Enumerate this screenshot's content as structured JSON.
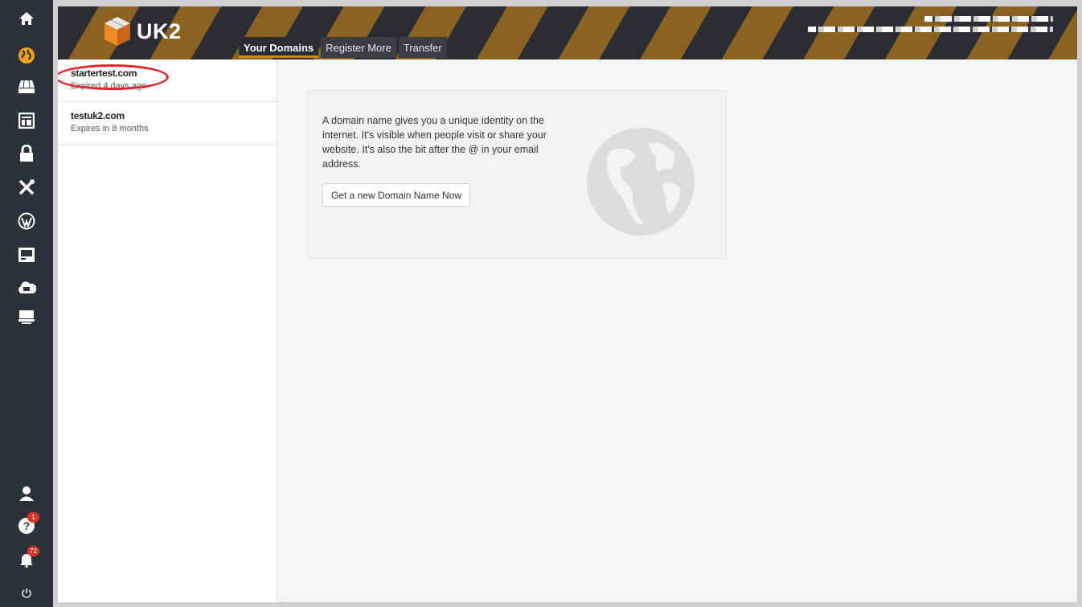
{
  "app": {
    "logo_text": "UK2"
  },
  "rail": {
    "top_icons": [
      "home-icon",
      "globe-icon",
      "hosting-icon",
      "layout-icon",
      "lock-icon",
      "tools-icon",
      "wordpress-icon",
      "server-icon",
      "cloud-icon",
      "dedicated-server-icon"
    ],
    "bottom_icons": [
      "user-icon",
      "help-icon",
      "bell-icon",
      "power-icon"
    ],
    "help_badge": "1",
    "notifications_badge": "72",
    "active_color": "#f0a020"
  },
  "tabs": [
    {
      "label": "Your Domains",
      "active": true
    },
    {
      "label": "Register More",
      "active": false
    },
    {
      "label": "Transfer",
      "active": false
    }
  ],
  "domains": [
    {
      "name": "startertest.com",
      "status": "Expired 4 days ago"
    },
    {
      "name": "testuk2.com",
      "status": "Expires in 8 months"
    }
  ],
  "card": {
    "description": "A domain name gives you a unique identity on the internet. It's visible when people visit or share your website. It's also the bit after the @ in your email address.",
    "button_label": "Get a new Domain Name Now"
  },
  "colors": {
    "accent": "#c98a1f",
    "header_bg": "#2b2d33",
    "stripe": "#8a6323",
    "highlight": "#e3242b"
  }
}
